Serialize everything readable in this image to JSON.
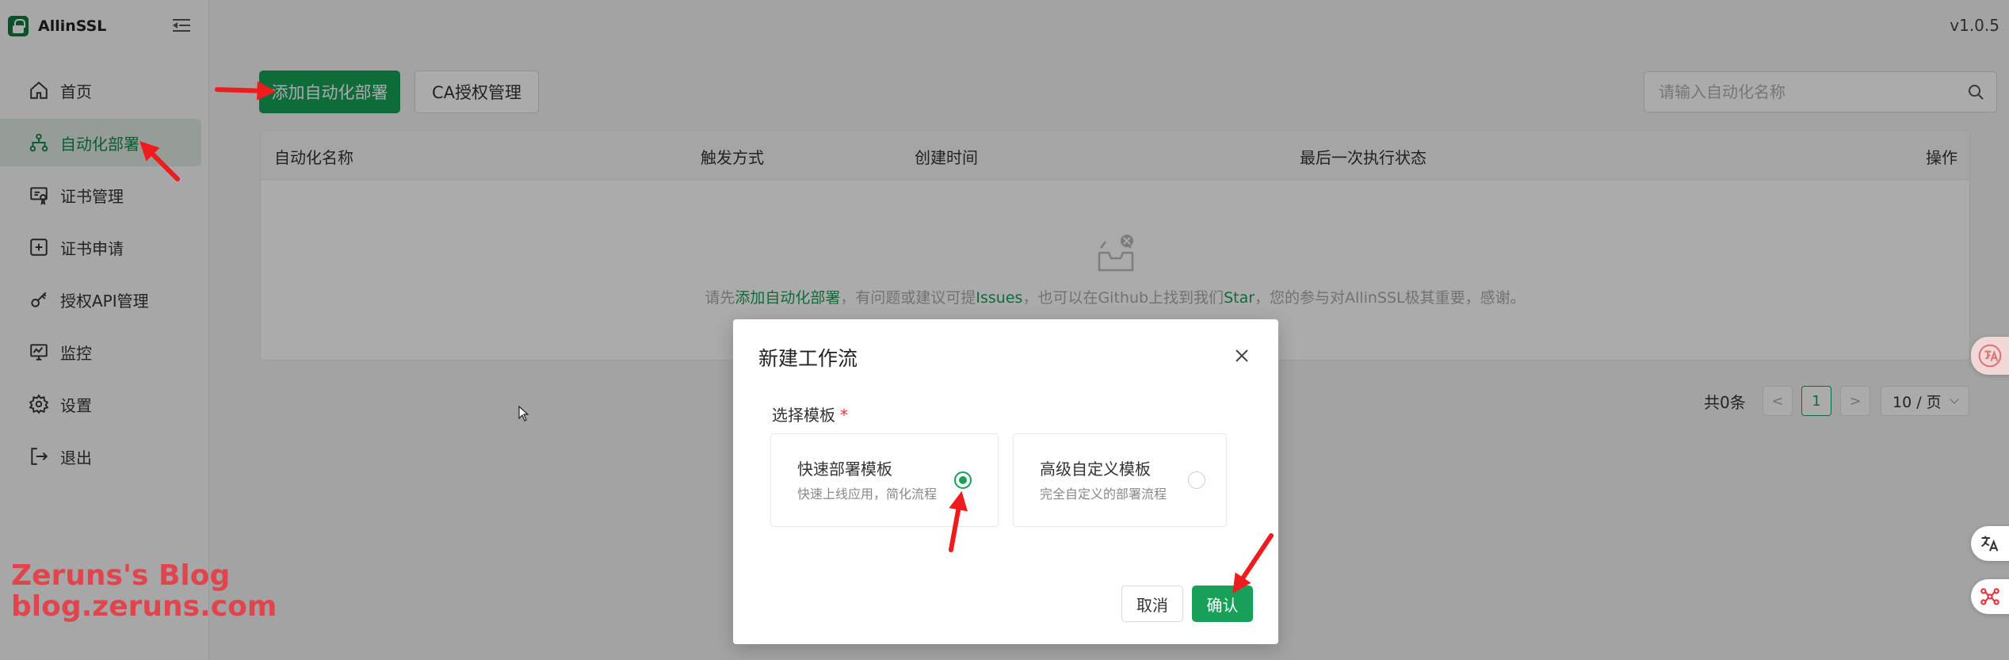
{
  "brand": {
    "name": "AllinSSL"
  },
  "version": "v1.0.5",
  "sidebar": {
    "items": [
      {
        "label": "首页"
      },
      {
        "label": "自动化部署"
      },
      {
        "label": "证书管理"
      },
      {
        "label": "证书申请"
      },
      {
        "label": "授权API管理"
      },
      {
        "label": "监控"
      },
      {
        "label": "设置"
      },
      {
        "label": "退出"
      }
    ]
  },
  "toolbar": {
    "add_label": "添加自动化部署",
    "ca_label": "CA授权管理",
    "search_placeholder": "请输入自动化名称"
  },
  "table": {
    "columns": [
      "自动化名称",
      "触发方式",
      "创建时间",
      "最后一次执行状态",
      "操作"
    ],
    "empty": {
      "p1": "请先",
      "l1": "添加自动化部署",
      "p2": "，有问题或建议可提",
      "l2": "Issues",
      "p3": "，也可以在Github上找到我们",
      "l3": "Star",
      "p4": "，您的参与对AllinSSL极其重要，感谢。"
    }
  },
  "pagination": {
    "total": "共0条",
    "prev": "<",
    "current": "1",
    "next": ">",
    "page_size": "10 / 页"
  },
  "modal": {
    "title": "新建工作流",
    "field_label": "选择模板",
    "required_mark": "*",
    "templates": [
      {
        "title": "快速部署模板",
        "desc": "快速上线应用，简化流程",
        "selected": true
      },
      {
        "title": "高级自定义模板",
        "desc": "完全自定义的部署流程",
        "selected": false
      }
    ],
    "cancel": "取消",
    "confirm": "确认"
  },
  "watermark": {
    "line1": "Zeruns's Blog",
    "line2": "blog.zeruns.com"
  },
  "colors": {
    "primary": "#18a058",
    "active_bg": "#e0e9e3",
    "annotation": "#ee1c1c",
    "watermark": "#e0454e"
  },
  "icons": [
    "home-icon",
    "workflow-icon",
    "certificate-icon",
    "plus-square-icon",
    "key-icon",
    "monitor-icon",
    "gear-icon",
    "logout-icon",
    "search-icon",
    "close-icon",
    "empty-box-icon",
    "translate-icon",
    "mindmap-icon"
  ]
}
